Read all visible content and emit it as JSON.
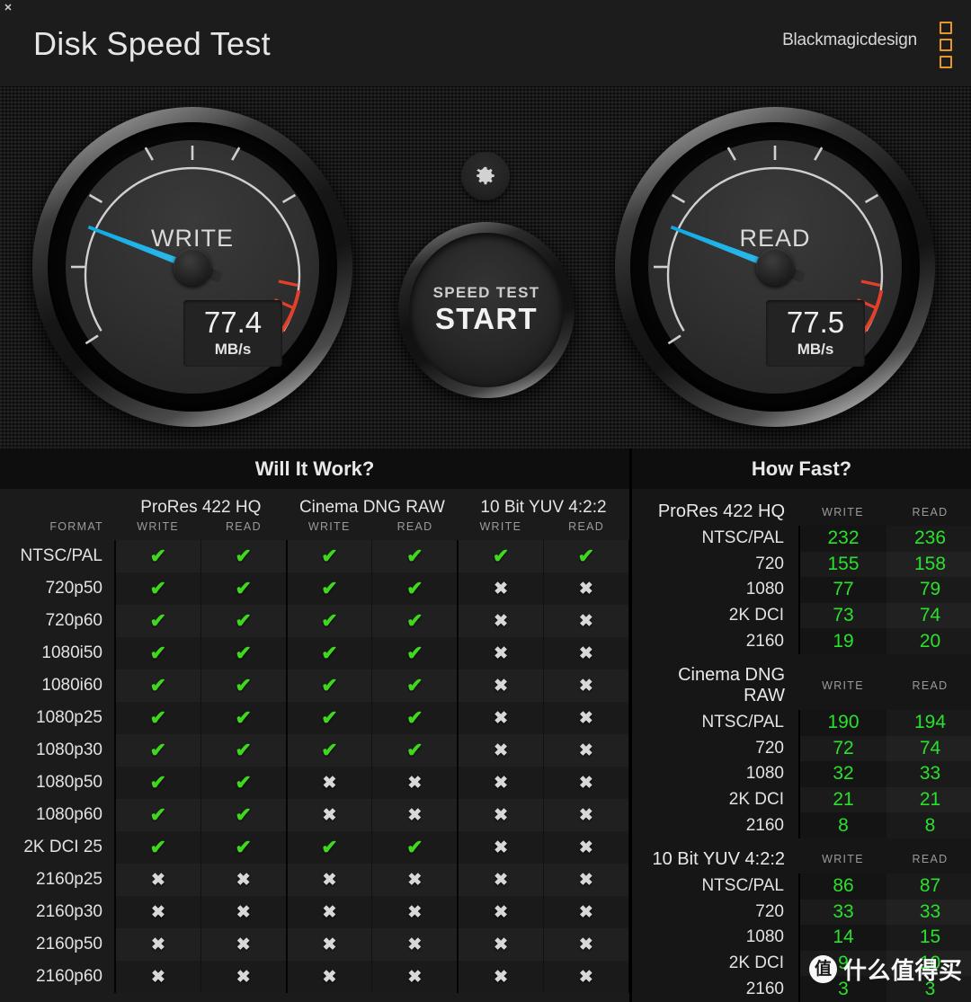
{
  "window": {
    "close_label": "✕"
  },
  "header": {
    "title": "Disk Speed Test",
    "brand": "Blackmagicdesign"
  },
  "gauges": {
    "write": {
      "label": "WRITE",
      "value": "77.4",
      "unit": "MB/s",
      "needle_color": "#1fb3e8"
    },
    "read": {
      "label": "READ",
      "value": "77.5",
      "unit": "MB/s",
      "needle_color": "#1fb3e8"
    },
    "start_button": {
      "line1": "SPEED TEST",
      "line2": "START"
    },
    "settings_icon": "gear-icon"
  },
  "will_it_work": {
    "title": "Will It Work?",
    "format_header": "FORMAT",
    "codecs": [
      "ProRes 422 HQ",
      "Cinema DNG RAW",
      "10 Bit YUV 4:2:2"
    ],
    "sub_headers": [
      "WRITE",
      "READ"
    ],
    "ok_glyph": "✔",
    "no_glyph": "✖",
    "rows": [
      {
        "format": "NTSC/PAL",
        "cells": [
          true,
          true,
          true,
          true,
          true,
          true
        ]
      },
      {
        "format": "720p50",
        "cells": [
          true,
          true,
          true,
          true,
          false,
          false
        ]
      },
      {
        "format": "720p60",
        "cells": [
          true,
          true,
          true,
          true,
          false,
          false
        ]
      },
      {
        "format": "1080i50",
        "cells": [
          true,
          true,
          true,
          true,
          false,
          false
        ]
      },
      {
        "format": "1080i60",
        "cells": [
          true,
          true,
          true,
          true,
          false,
          false
        ]
      },
      {
        "format": "1080p25",
        "cells": [
          true,
          true,
          true,
          true,
          false,
          false
        ]
      },
      {
        "format": "1080p30",
        "cells": [
          true,
          true,
          true,
          true,
          false,
          false
        ]
      },
      {
        "format": "1080p50",
        "cells": [
          true,
          true,
          false,
          false,
          false,
          false
        ]
      },
      {
        "format": "1080p60",
        "cells": [
          true,
          true,
          false,
          false,
          false,
          false
        ]
      },
      {
        "format": "2K DCI 25",
        "cells": [
          true,
          true,
          true,
          true,
          false,
          false
        ]
      },
      {
        "format": "2160p25",
        "cells": [
          false,
          false,
          false,
          false,
          false,
          false
        ]
      },
      {
        "format": "2160p30",
        "cells": [
          false,
          false,
          false,
          false,
          false,
          false
        ]
      },
      {
        "format": "2160p50",
        "cells": [
          false,
          false,
          false,
          false,
          false,
          false
        ]
      },
      {
        "format": "2160p60",
        "cells": [
          false,
          false,
          false,
          false,
          false,
          false
        ]
      }
    ]
  },
  "how_fast": {
    "title": "How Fast?",
    "sub_headers": [
      "WRITE",
      "READ"
    ],
    "sections": [
      {
        "name": "ProRes 422 HQ",
        "rows": [
          {
            "label": "NTSC/PAL",
            "write": "232",
            "read": "236"
          },
          {
            "label": "720",
            "write": "155",
            "read": "158"
          },
          {
            "label": "1080",
            "write": "77",
            "read": "79"
          },
          {
            "label": "2K DCI",
            "write": "73",
            "read": "74"
          },
          {
            "label": "2160",
            "write": "19",
            "read": "20"
          }
        ]
      },
      {
        "name": "Cinema DNG RAW",
        "rows": [
          {
            "label": "NTSC/PAL",
            "write": "190",
            "read": "194"
          },
          {
            "label": "720",
            "write": "72",
            "read": "74"
          },
          {
            "label": "1080",
            "write": "32",
            "read": "33"
          },
          {
            "label": "2K DCI",
            "write": "21",
            "read": "21"
          },
          {
            "label": "2160",
            "write": "8",
            "read": "8"
          }
        ]
      },
      {
        "name": "10 Bit YUV 4:2:2",
        "rows": [
          {
            "label": "NTSC/PAL",
            "write": "86",
            "read": "87"
          },
          {
            "label": "720",
            "write": "33",
            "read": "33"
          },
          {
            "label": "1080",
            "write": "14",
            "read": "15"
          },
          {
            "label": "2K DCI",
            "write": "9",
            "read": "10"
          },
          {
            "label": "2160",
            "write": "3",
            "read": "3"
          }
        ]
      }
    ]
  },
  "watermark": {
    "logo_char": "值",
    "text": "什么值得买"
  }
}
